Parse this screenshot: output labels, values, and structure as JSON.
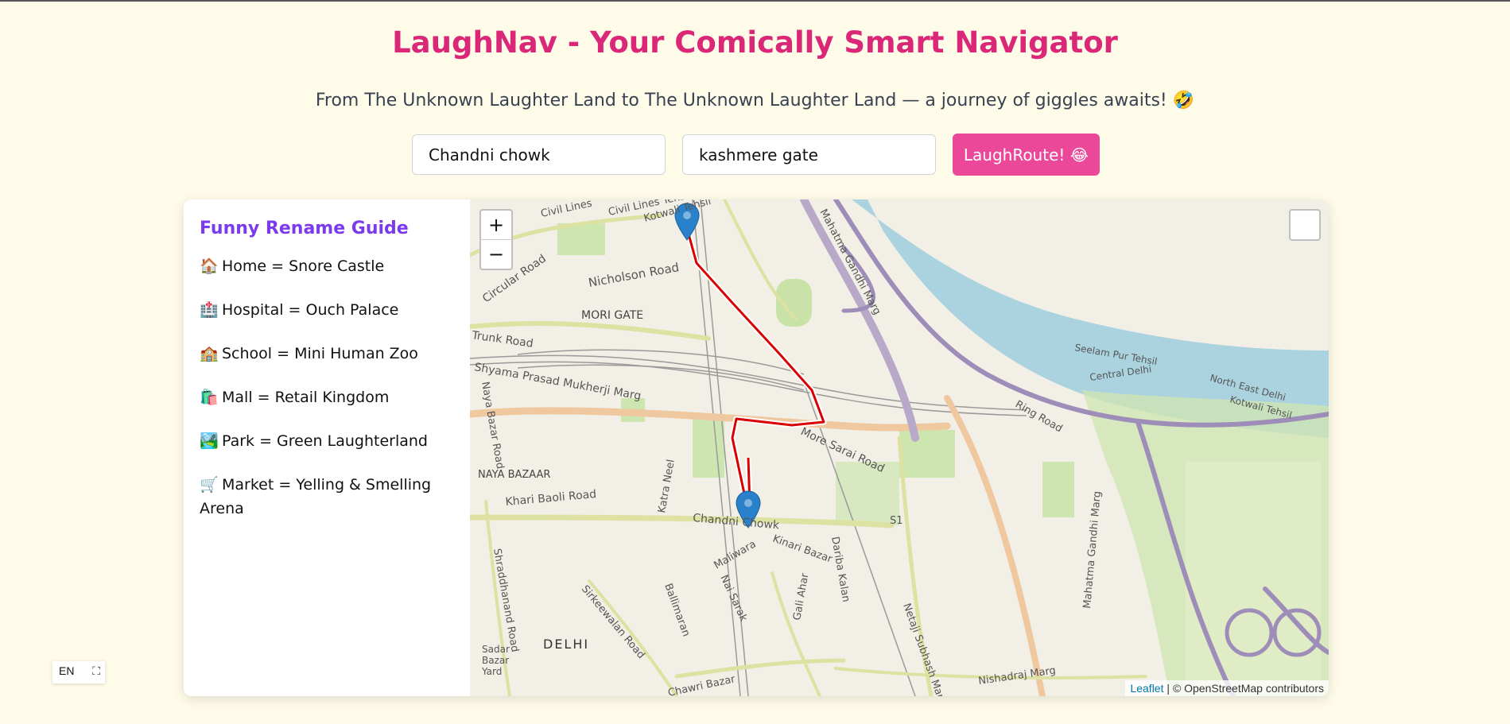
{
  "header": {
    "title": "LaughNav - Your Comically Smart Navigator",
    "subtitle": "From The Unknown Laughter Land to The Unknown Laughter Land — a journey of giggles awaits! 🤣"
  },
  "form": {
    "from_value": "Chandni chowk",
    "to_value": "kashmere gate",
    "route_button": "LaughRoute! 😂"
  },
  "guide": {
    "title": "Funny Rename Guide",
    "items": [
      {
        "icon": "🏠",
        "text": "Home = Snore Castle"
      },
      {
        "icon": "🏥",
        "text": "Hospital = Ouch Palace"
      },
      {
        "icon": "🏫",
        "text": "School = Mini Human Zoo"
      },
      {
        "icon": "🛍️",
        "text": "Mall = Retail Kingdom"
      },
      {
        "icon": "🏞️",
        "text": "Park = Green Laughterland"
      },
      {
        "icon": "🛒",
        "text": "Market = Yelling & Smelling Arena"
      }
    ]
  },
  "map": {
    "zoom_in": "+",
    "zoom_out": "−",
    "attribution_link": "Leaflet",
    "attribution_text": " | © OpenStreetMap contributors",
    "labels": {
      "civil_lines": "Civil Lines",
      "civil_lines_tehsil": "Civil Lines Tehsil",
      "kotwali_tehsil": "Kotwali Tehsil",
      "mahatma_gandhi_marg": "Mahatma Gandhi Marg",
      "nicholson_road": "Nicholson Road",
      "circular_road": "Circular Road",
      "mori_gate": "MORI GATE",
      "trunk_road": "Trunk Road",
      "spm_marg": "Shyama Prasad Mukherji Marg",
      "naya_bazar_road": "Naya Bazar Road",
      "naya_bazaar": "NAYA BAZAAR",
      "khari_baoli_road": "Khari Baoli Road",
      "katra_neel": "Katra Neel",
      "chandni_chowk": "Chandni Chowk",
      "more_sarai_road": "More Sarai Road",
      "maliwara": "Maliwara",
      "kinari_bazar": "Kinari Bazar",
      "dariba_kalan": "Dariba Kalan",
      "s1": "S1",
      "nai_sarak": "Nai Sarak",
      "ballimaran": "Ballimaran",
      "gali_ahar": "Gali Ahar",
      "sirkeewalan_road": "Sirkeewalan Road",
      "shraddhanand_road": "Shraddhanand Road",
      "delhi": "DELHI",
      "sadar_bazar": "Sadar",
      "sadar_bazar2": "Bazar",
      "sadar_bazar3": "Yard",
      "chawri_bazar": "Chawri Bazar",
      "netaji_marg": "Netaji Subhash Marg",
      "nishadraj_marg": "Nishadraj Marg",
      "ring_road": "Ring Road",
      "central_delhi": "Central Delhi",
      "north_east_delhi": "North East Delhi",
      "kotwali_tehsil2": "Kotwali Tehsil",
      "seelam_pur": "Seelam Pur Tehsil",
      "ne_kotwali": "North East Delhi Kotwali Tehsil",
      "mg_marg2": "Mahatma Gandhi Marg"
    }
  },
  "lang": {
    "code": "EN",
    "fullscreen_icon": "fullscreen-icon"
  }
}
